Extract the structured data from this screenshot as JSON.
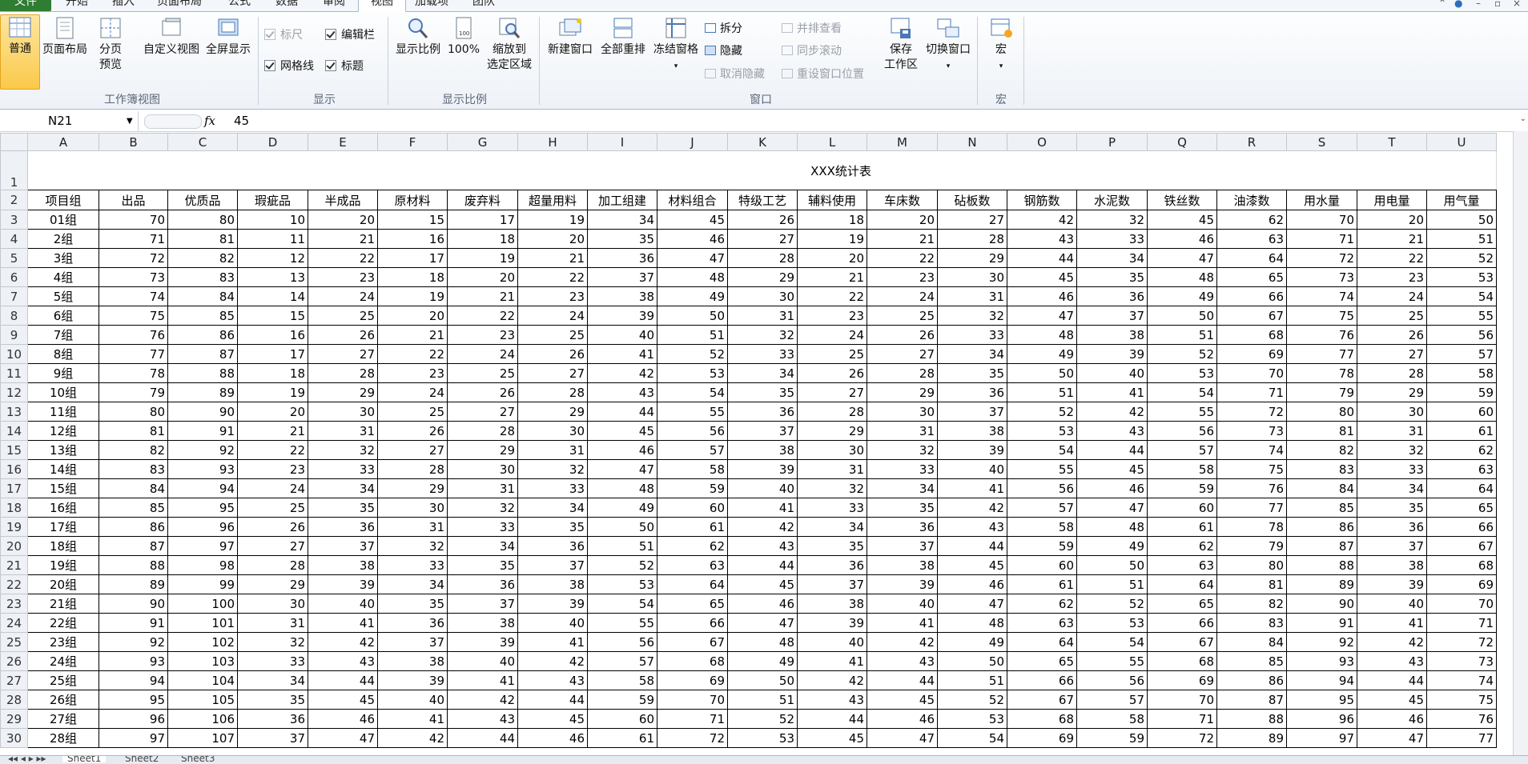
{
  "tabs": [
    "文件",
    "开始",
    "插入",
    "页面布局",
    "公式",
    "数据",
    "审阅",
    "视图",
    "加载项",
    "团队"
  ],
  "active_tab": "视图",
  "ribbon": {
    "workbook_views": {
      "normal": "普通",
      "page_layout": "页面布局",
      "page_break_1": "分页",
      "page_break_2": "预览",
      "custom_views": "自定义视图",
      "full_screen": "全屏显示",
      "group": "工作簿视图"
    },
    "show": {
      "ruler": "标尺",
      "formula_bar": "编辑栏",
      "gridlines": "网格线",
      "headings": "标题",
      "group": "显示"
    },
    "zoom": {
      "zoom": "显示比例",
      "zoom100": "100%",
      "zoom_sel_1": "缩放到",
      "zoom_sel_2": "选定区域",
      "group": "显示比例"
    },
    "window": {
      "new_window": "新建窗口",
      "arrange_all": "全部重排",
      "freeze_panes": "冻结窗格",
      "split": "拆分",
      "hide": "隐藏",
      "unhide": "取消隐藏",
      "side_by_side": "并排查看",
      "sync_scroll": "同步滚动",
      "reset_pos": "重设窗口位置",
      "save_ws_1": "保存",
      "save_ws_2": "工作区",
      "switch": "切换窗口",
      "group": "窗口"
    },
    "macros": {
      "macros": "宏",
      "group": "宏"
    }
  },
  "formula_bar": {
    "name_box": "N21",
    "fx": "fx",
    "value": "45"
  },
  "sheet": {
    "title": "XXX统计表",
    "col_letters": [
      "A",
      "B",
      "C",
      "D",
      "E",
      "F",
      "G",
      "H",
      "I",
      "J",
      "K",
      "L",
      "M",
      "N",
      "O",
      "P",
      "Q",
      "R",
      "S",
      "T",
      "U"
    ],
    "headers": [
      "项目组",
      "出品",
      "优质品",
      "瑕疵品",
      "半成品",
      "原材料",
      "废弃料",
      "超量用料",
      "加工组建",
      "材料组合",
      "特级工艺",
      "辅料使用",
      "车床数",
      "砧板数",
      "钢筋数",
      "水泥数",
      "铁丝数",
      "油漆数",
      "用水量",
      "用电量",
      "用气量"
    ],
    "row_numbers": [
      "1",
      "2",
      "3",
      "4",
      "5",
      "6",
      "7",
      "8",
      "9",
      "10",
      "11",
      "12",
      "13",
      "14",
      "15",
      "16",
      "17",
      "18",
      "19",
      "20",
      "21",
      "22",
      "23",
      "24",
      "25",
      "26",
      "27",
      "28",
      "29",
      "30"
    ],
    "rows": [
      [
        "01组",
        "70",
        "80",
        "10",
        "20",
        "15",
        "17",
        "19",
        "34",
        "45",
        "26",
        "18",
        "20",
        "27",
        "42",
        "32",
        "45",
        "62",
        "70",
        "20",
        "50"
      ],
      [
        "2组",
        "71",
        "81",
        "11",
        "21",
        "16",
        "18",
        "20",
        "35",
        "46",
        "27",
        "19",
        "21",
        "28",
        "43",
        "33",
        "46",
        "63",
        "71",
        "21",
        "51"
      ],
      [
        "3组",
        "72",
        "82",
        "12",
        "22",
        "17",
        "19",
        "21",
        "36",
        "47",
        "28",
        "20",
        "22",
        "29",
        "44",
        "34",
        "47",
        "64",
        "72",
        "22",
        "52"
      ],
      [
        "4组",
        "73",
        "83",
        "13",
        "23",
        "18",
        "20",
        "22",
        "37",
        "48",
        "29",
        "21",
        "23",
        "30",
        "45",
        "35",
        "48",
        "65",
        "73",
        "23",
        "53"
      ],
      [
        "5组",
        "74",
        "84",
        "14",
        "24",
        "19",
        "21",
        "23",
        "38",
        "49",
        "30",
        "22",
        "24",
        "31",
        "46",
        "36",
        "49",
        "66",
        "74",
        "24",
        "54"
      ],
      [
        "6组",
        "75",
        "85",
        "15",
        "25",
        "20",
        "22",
        "24",
        "39",
        "50",
        "31",
        "23",
        "25",
        "32",
        "47",
        "37",
        "50",
        "67",
        "75",
        "25",
        "55"
      ],
      [
        "7组",
        "76",
        "86",
        "16",
        "26",
        "21",
        "23",
        "25",
        "40",
        "51",
        "32",
        "24",
        "26",
        "33",
        "48",
        "38",
        "51",
        "68",
        "76",
        "26",
        "56"
      ],
      [
        "8组",
        "77",
        "87",
        "17",
        "27",
        "22",
        "24",
        "26",
        "41",
        "52",
        "33",
        "25",
        "27",
        "34",
        "49",
        "39",
        "52",
        "69",
        "77",
        "27",
        "57"
      ],
      [
        "9组",
        "78",
        "88",
        "18",
        "28",
        "23",
        "25",
        "27",
        "42",
        "53",
        "34",
        "26",
        "28",
        "35",
        "50",
        "40",
        "53",
        "70",
        "78",
        "28",
        "58"
      ],
      [
        "10组",
        "79",
        "89",
        "19",
        "29",
        "24",
        "26",
        "28",
        "43",
        "54",
        "35",
        "27",
        "29",
        "36",
        "51",
        "41",
        "54",
        "71",
        "79",
        "29",
        "59"
      ],
      [
        "11组",
        "80",
        "90",
        "20",
        "30",
        "25",
        "27",
        "29",
        "44",
        "55",
        "36",
        "28",
        "30",
        "37",
        "52",
        "42",
        "55",
        "72",
        "80",
        "30",
        "60"
      ],
      [
        "12组",
        "81",
        "91",
        "21",
        "31",
        "26",
        "28",
        "30",
        "45",
        "56",
        "37",
        "29",
        "31",
        "38",
        "53",
        "43",
        "56",
        "73",
        "81",
        "31",
        "61"
      ],
      [
        "13组",
        "82",
        "92",
        "22",
        "32",
        "27",
        "29",
        "31",
        "46",
        "57",
        "38",
        "30",
        "32",
        "39",
        "54",
        "44",
        "57",
        "74",
        "82",
        "32",
        "62"
      ],
      [
        "14组",
        "83",
        "93",
        "23",
        "33",
        "28",
        "30",
        "32",
        "47",
        "58",
        "39",
        "31",
        "33",
        "40",
        "55",
        "45",
        "58",
        "75",
        "83",
        "33",
        "63"
      ],
      [
        "15组",
        "84",
        "94",
        "24",
        "34",
        "29",
        "31",
        "33",
        "48",
        "59",
        "40",
        "32",
        "34",
        "41",
        "56",
        "46",
        "59",
        "76",
        "84",
        "34",
        "64"
      ],
      [
        "16组",
        "85",
        "95",
        "25",
        "35",
        "30",
        "32",
        "34",
        "49",
        "60",
        "41",
        "33",
        "35",
        "42",
        "57",
        "47",
        "60",
        "77",
        "85",
        "35",
        "65"
      ],
      [
        "17组",
        "86",
        "96",
        "26",
        "36",
        "31",
        "33",
        "35",
        "50",
        "61",
        "42",
        "34",
        "36",
        "43",
        "58",
        "48",
        "61",
        "78",
        "86",
        "36",
        "66"
      ],
      [
        "18组",
        "87",
        "97",
        "27",
        "37",
        "32",
        "34",
        "36",
        "51",
        "62",
        "43",
        "35",
        "37",
        "44",
        "59",
        "49",
        "62",
        "79",
        "87",
        "37",
        "67"
      ],
      [
        "19组",
        "88",
        "98",
        "28",
        "38",
        "33",
        "35",
        "37",
        "52",
        "63",
        "44",
        "36",
        "38",
        "45",
        "60",
        "50",
        "63",
        "80",
        "88",
        "38",
        "68"
      ],
      [
        "20组",
        "89",
        "99",
        "29",
        "39",
        "34",
        "36",
        "38",
        "53",
        "64",
        "45",
        "37",
        "39",
        "46",
        "61",
        "51",
        "64",
        "81",
        "89",
        "39",
        "69"
      ],
      [
        "21组",
        "90",
        "100",
        "30",
        "40",
        "35",
        "37",
        "39",
        "54",
        "65",
        "46",
        "38",
        "40",
        "47",
        "62",
        "52",
        "65",
        "82",
        "90",
        "40",
        "70"
      ],
      [
        "22组",
        "91",
        "101",
        "31",
        "41",
        "36",
        "38",
        "40",
        "55",
        "66",
        "47",
        "39",
        "41",
        "48",
        "63",
        "53",
        "66",
        "83",
        "91",
        "41",
        "71"
      ],
      [
        "23组",
        "92",
        "102",
        "32",
        "42",
        "37",
        "39",
        "41",
        "56",
        "67",
        "48",
        "40",
        "42",
        "49",
        "64",
        "54",
        "67",
        "84",
        "92",
        "42",
        "72"
      ],
      [
        "24组",
        "93",
        "103",
        "33",
        "43",
        "38",
        "40",
        "42",
        "57",
        "68",
        "49",
        "41",
        "43",
        "50",
        "65",
        "55",
        "68",
        "85",
        "93",
        "43",
        "73"
      ],
      [
        "25组",
        "94",
        "104",
        "34",
        "44",
        "39",
        "41",
        "43",
        "58",
        "69",
        "50",
        "42",
        "44",
        "51",
        "66",
        "56",
        "69",
        "86",
        "94",
        "44",
        "74"
      ],
      [
        "26组",
        "95",
        "105",
        "35",
        "45",
        "40",
        "42",
        "44",
        "59",
        "70",
        "51",
        "43",
        "45",
        "52",
        "67",
        "57",
        "70",
        "87",
        "95",
        "45",
        "75"
      ],
      [
        "27组",
        "96",
        "106",
        "36",
        "46",
        "41",
        "43",
        "45",
        "60",
        "71",
        "52",
        "44",
        "46",
        "53",
        "68",
        "58",
        "71",
        "88",
        "96",
        "46",
        "76"
      ],
      [
        "28组",
        "97",
        "107",
        "37",
        "47",
        "42",
        "44",
        "46",
        "61",
        "72",
        "53",
        "45",
        "47",
        "54",
        "69",
        "59",
        "72",
        "89",
        "97",
        "47",
        "77"
      ]
    ]
  },
  "sheet_tabs": [
    "Sheet1",
    "Sheet2",
    "Sheet3"
  ],
  "colors": {
    "file_tab": "#2f7d32",
    "selected_button": "#fbc94a",
    "grid_line": "#d4d8de",
    "header_bg": "#eef1f5"
  }
}
